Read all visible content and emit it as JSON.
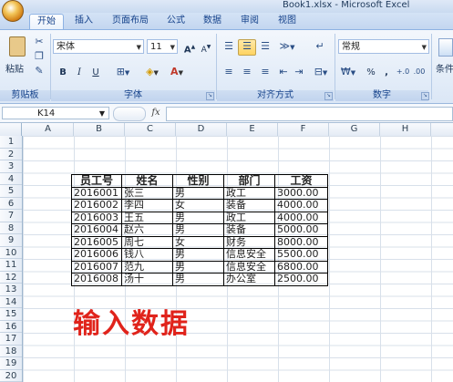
{
  "window": {
    "title": "Book1.xlsx - Microsoft Excel"
  },
  "tabs": [
    "开始",
    "插入",
    "页面布局",
    "公式",
    "数据",
    "审阅",
    "视图"
  ],
  "active_tab": "开始",
  "ribbon": {
    "clipboard": {
      "paste_label": "粘贴",
      "group_label": "剪贴板"
    },
    "font": {
      "font_name": "宋体",
      "font_size": "11",
      "group_label": "字体",
      "bold": "B",
      "italic": "I",
      "underline": "U",
      "grow": "A",
      "shrink": "A"
    },
    "alignment": {
      "group_label": "对齐方式"
    },
    "number": {
      "format": "常规",
      "percent": "%",
      "comma": ",",
      "group_label": "数字"
    },
    "styles": {
      "label": "条件"
    }
  },
  "formula_bar": {
    "name_box": "K14",
    "fx": "fx",
    "value": ""
  },
  "columns": [
    "A",
    "B",
    "C",
    "D",
    "E",
    "F",
    "G",
    "H"
  ],
  "rows": [
    "1",
    "2",
    "3",
    "4",
    "5",
    "6",
    "7",
    "8",
    "9",
    "10",
    "11",
    "12",
    "13",
    "14",
    "15",
    "16",
    "17",
    "18",
    "19",
    "20"
  ],
  "table": {
    "headers": [
      "员工号",
      "姓名",
      "性别",
      "部门",
      "工资"
    ],
    "rows": [
      [
        "2016001",
        "张三",
        "男",
        "政工",
        "3000.00"
      ],
      [
        "2016002",
        "李四",
        "女",
        "装备",
        "4000.00"
      ],
      [
        "2016003",
        "王五",
        "男",
        "政工",
        "4000.00"
      ],
      [
        "2016004",
        "赵六",
        "男",
        "装备",
        "5000.00"
      ],
      [
        "2016005",
        "周七",
        "女",
        "财务",
        "8000.00"
      ],
      [
        "2016006",
        "钱八",
        "男",
        "信息安全",
        "5500.00"
      ],
      [
        "2016007",
        "范九",
        "男",
        "信息安全",
        "6800.00"
      ],
      [
        "2016008",
        "汤十",
        "男",
        "办公室",
        "2500.00"
      ]
    ]
  },
  "annotation": "输入数据",
  "colors": {
    "annotation": "#e0231b",
    "ribbon_text": "#15428b"
  }
}
